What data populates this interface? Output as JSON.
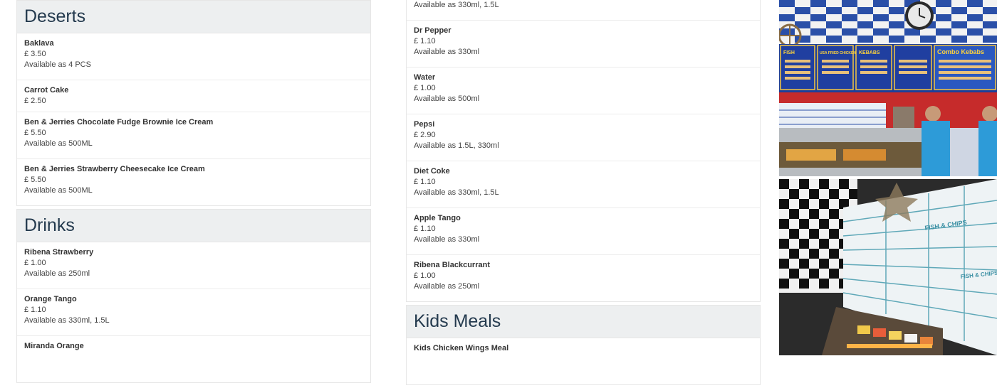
{
  "left": {
    "deserts": {
      "title": "Deserts",
      "items": [
        {
          "name": "Baklava",
          "price": "£ 3.50",
          "avail": "Available as 4 PCS"
        },
        {
          "name": "Carrot Cake",
          "price": "£ 2.50",
          "avail": ""
        },
        {
          "name": "Ben & Jerries Chocolate Fudge Brownie Ice Cream",
          "price": "£ 5.50",
          "avail": "Available as 500ML"
        },
        {
          "name": "Ben & Jerries Strawberry Cheesecake Ice Cream",
          "price": "£ 5.50",
          "avail": "Available as 500ML"
        }
      ]
    },
    "drinks": {
      "title": "Drinks",
      "items": [
        {
          "name": "Ribena Strawberry",
          "price": "£ 1.00",
          "avail": "Available as 250ml"
        },
        {
          "name": "Orange Tango",
          "price": "£ 1.10",
          "avail": "Available as 330ml, 1.5L"
        },
        {
          "name": "Miranda Orange",
          "price": "",
          "avail": ""
        }
      ]
    }
  },
  "middle": {
    "partial_top": {
      "avail": "Available as 330ml, 1.5L"
    },
    "items": [
      {
        "name": "Dr Pepper",
        "price": "£ 1.10",
        "avail": "Available as 330ml"
      },
      {
        "name": "Water",
        "price": "£ 1.00",
        "avail": "Available as 500ml"
      },
      {
        "name": "Pepsi",
        "price": "£ 2.90",
        "avail": "Available as 1.5L, 330ml"
      },
      {
        "name": "Diet Coke",
        "price": "£ 1.10",
        "avail": "Available as 330ml, 1.5L"
      },
      {
        "name": "Apple Tango",
        "price": "£ 1.10",
        "avail": "Available as 330ml"
      },
      {
        "name": "Ribena Blackcurrant",
        "price": "£ 1.00",
        "avail": "Available as 250ml"
      }
    ],
    "kids": {
      "title": "Kids Meals",
      "items": [
        {
          "name": "Kids Chicken Wings Meal",
          "price": "",
          "avail": ""
        }
      ]
    }
  },
  "photos": {
    "top": {
      "menu_board_headers": [
        "FISH",
        "USA FRIED CHICKEN",
        "KEBABS",
        "Combo Kebabs"
      ]
    },
    "bottom": {
      "box_label": "FISH & CHIPS"
    }
  },
  "colors": {
    "header_bg": "#edeff0",
    "header_text": "#243a4e",
    "border": "#e6e6e6",
    "menu_board_blue": "#1d3f9a",
    "tile_blue": "#2a4fa8"
  }
}
